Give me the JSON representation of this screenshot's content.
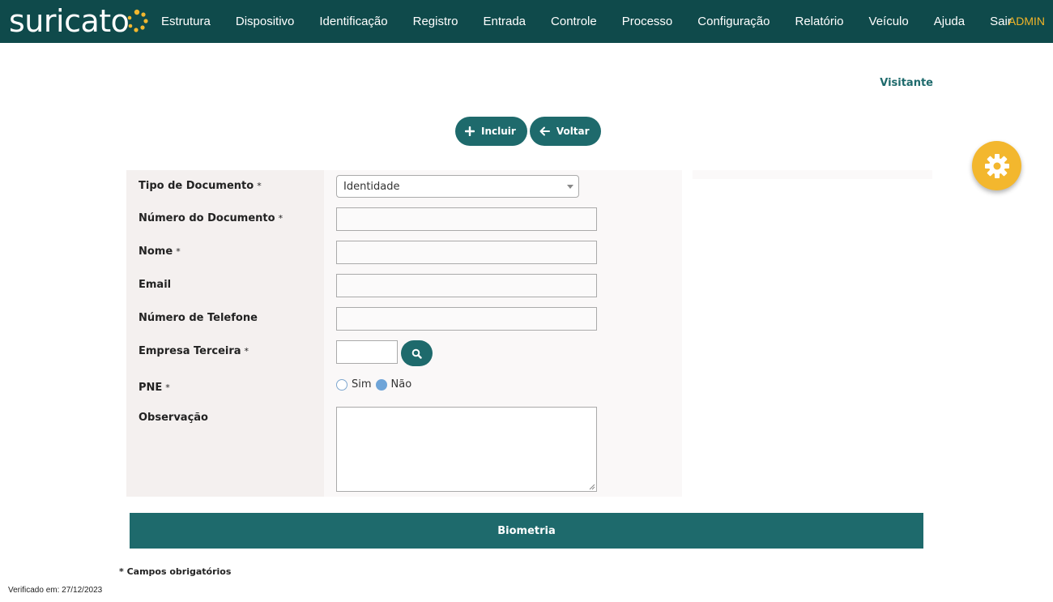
{
  "header": {
    "logo_text": "suricato",
    "nav_items": [
      "Estrutura",
      "Dispositivo",
      "Identificação",
      "Registro",
      "Entrada",
      "Controle",
      "Processo",
      "Configuração",
      "Relatório",
      "Veículo",
      "Ajuda",
      "Sair"
    ],
    "user": "ADMIN",
    "colors": {
      "bar": "#0f4a4b",
      "user": "#f0b428"
    }
  },
  "page": {
    "subtitle": "Visitante",
    "buttons": {
      "add_label": "Incluir",
      "back_label": "Voltar"
    }
  },
  "form": {
    "tipo_documento": {
      "label": "Tipo de Documento",
      "required_mark": "*",
      "value": "Identidade"
    },
    "numero_documento": {
      "label": "Número do Documento",
      "required_mark": "*",
      "value": ""
    },
    "nome": {
      "label": "Nome",
      "required_mark": "*",
      "value": ""
    },
    "email": {
      "label": "Email",
      "value": ""
    },
    "telefone": {
      "label": "Número de Telefone",
      "value": ""
    },
    "empresa": {
      "label": "Empresa Terceira",
      "required_mark": "*",
      "value": ""
    },
    "pne": {
      "label": "PNE",
      "required_mark": "*",
      "options": [
        "Sim",
        "Não"
      ],
      "selected": "Não"
    },
    "observacao": {
      "label": "Observação",
      "value": ""
    }
  },
  "biometria_label": "Biometria",
  "required_note": "* Campos obrigatórios",
  "verified_text": "Verificado em: 27/12/2023",
  "accent_color": "#1e6a6c",
  "fab_color": "#f3b72e"
}
